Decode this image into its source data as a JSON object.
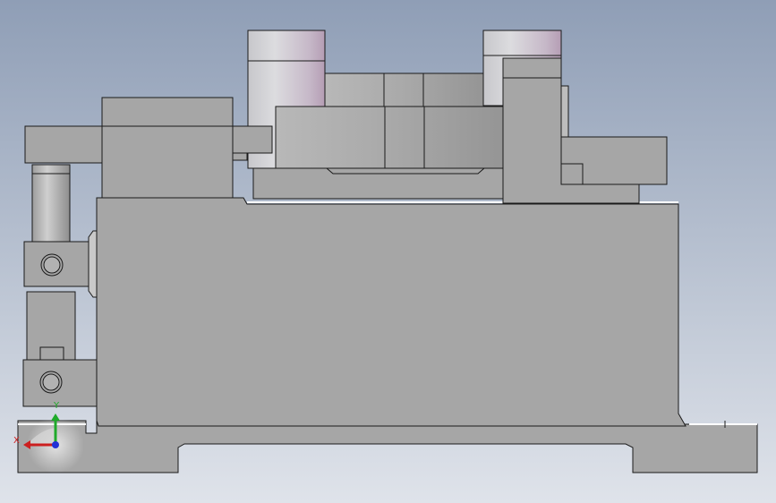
{
  "viewport": {
    "background_top": "#8f9eb6",
    "background_bottom": "#dfe3ea"
  },
  "model": {
    "body_color": "#a6a6a6",
    "edge_color": "#1a1a1a",
    "cylinder_light": "#d9d9dc",
    "cylinder_dark": "#b79fb4"
  },
  "triad": {
    "x_label": "X",
    "y_label": "Y",
    "x_color": "#cc1f1f",
    "y_color": "#1faa2a",
    "z_color": "#2332d6"
  }
}
